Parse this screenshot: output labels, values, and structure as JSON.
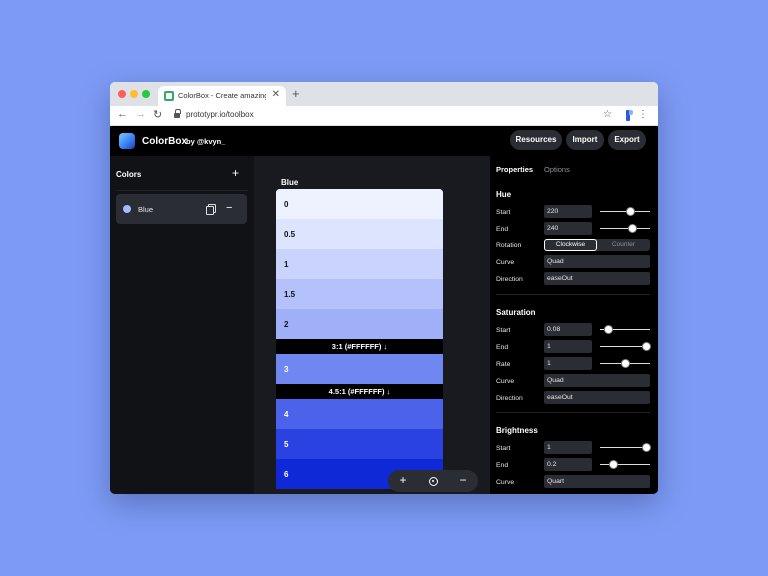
{
  "browser": {
    "tab_title": "ColorBox - Create amazing color",
    "url": "prototypr.io/toolbox"
  },
  "app": {
    "brand": "ColorBox",
    "brand_by": "by @kvyn_",
    "buttons": {
      "resources": "Resources",
      "import": "Import",
      "export": "Export"
    }
  },
  "sidebar": {
    "title": "Colors",
    "colors": [
      {
        "name": "Blue",
        "swatch": "#a9b8ff"
      }
    ]
  },
  "palette": {
    "title": "Blue",
    "shades": [
      {
        "label": "0",
        "bg": "#eef2ff",
        "fg": "#111111"
      },
      {
        "label": "0.5",
        "bg": "#dde4fd",
        "fg": "#111111"
      },
      {
        "label": "1",
        "bg": "#c9d3fb",
        "fg": "#111111"
      },
      {
        "label": "1.5",
        "bg": "#b4c1fa",
        "fg": "#111111"
      },
      {
        "label": "2",
        "bg": "#9fb0f8",
        "fg": "#111111"
      },
      {
        "label": "3",
        "bg": "#6f88f1",
        "fg": "#ffffff"
      },
      {
        "label": "4",
        "bg": "#4a63ea",
        "fg": "#ffffff"
      },
      {
        "label": "5",
        "bg": "#2b42e2",
        "fg": "#ffffff"
      },
      {
        "label": "6",
        "bg": "#1029d6",
        "fg": "#ffffff"
      }
    ],
    "contrast_3": "3:1 (#FFFFFF) ↓",
    "contrast_45": "4.5:1 (#FFFFFF) ↓"
  },
  "zoom": {
    "in": "+",
    "out": "−"
  },
  "panel": {
    "tabs": {
      "properties": "Properties",
      "options": "Options"
    },
    "hue": {
      "title": "Hue",
      "start_label": "Start",
      "start_value": "220",
      "start_level": 0.6,
      "end_label": "End",
      "end_value": "240",
      "end_level": 0.64,
      "rotation_label": "Rotation",
      "rotation_a": "Clockwise",
      "rotation_b": "Counter",
      "curve_label": "Curve",
      "curve_value": "Quad",
      "direction_label": "Direction",
      "direction_value": "easeOut"
    },
    "saturation": {
      "title": "Saturation",
      "start_label": "Start",
      "start_value": "0.08",
      "start_level": 0.16,
      "end_label": "End",
      "end_value": "1",
      "end_level": 0.92,
      "rate_label": "Rate",
      "rate_value": "1",
      "rate_level": 0.5,
      "curve_label": "Curve",
      "curve_value": "Quad",
      "direction_label": "Direction",
      "direction_value": "easeOut"
    },
    "brightness": {
      "title": "Brightness",
      "start_label": "Start",
      "start_value": "1",
      "start_level": 0.92,
      "end_label": "End",
      "end_value": "0.2",
      "end_level": 0.26,
      "curve_label": "Curve",
      "curve_value": "Quart"
    }
  }
}
